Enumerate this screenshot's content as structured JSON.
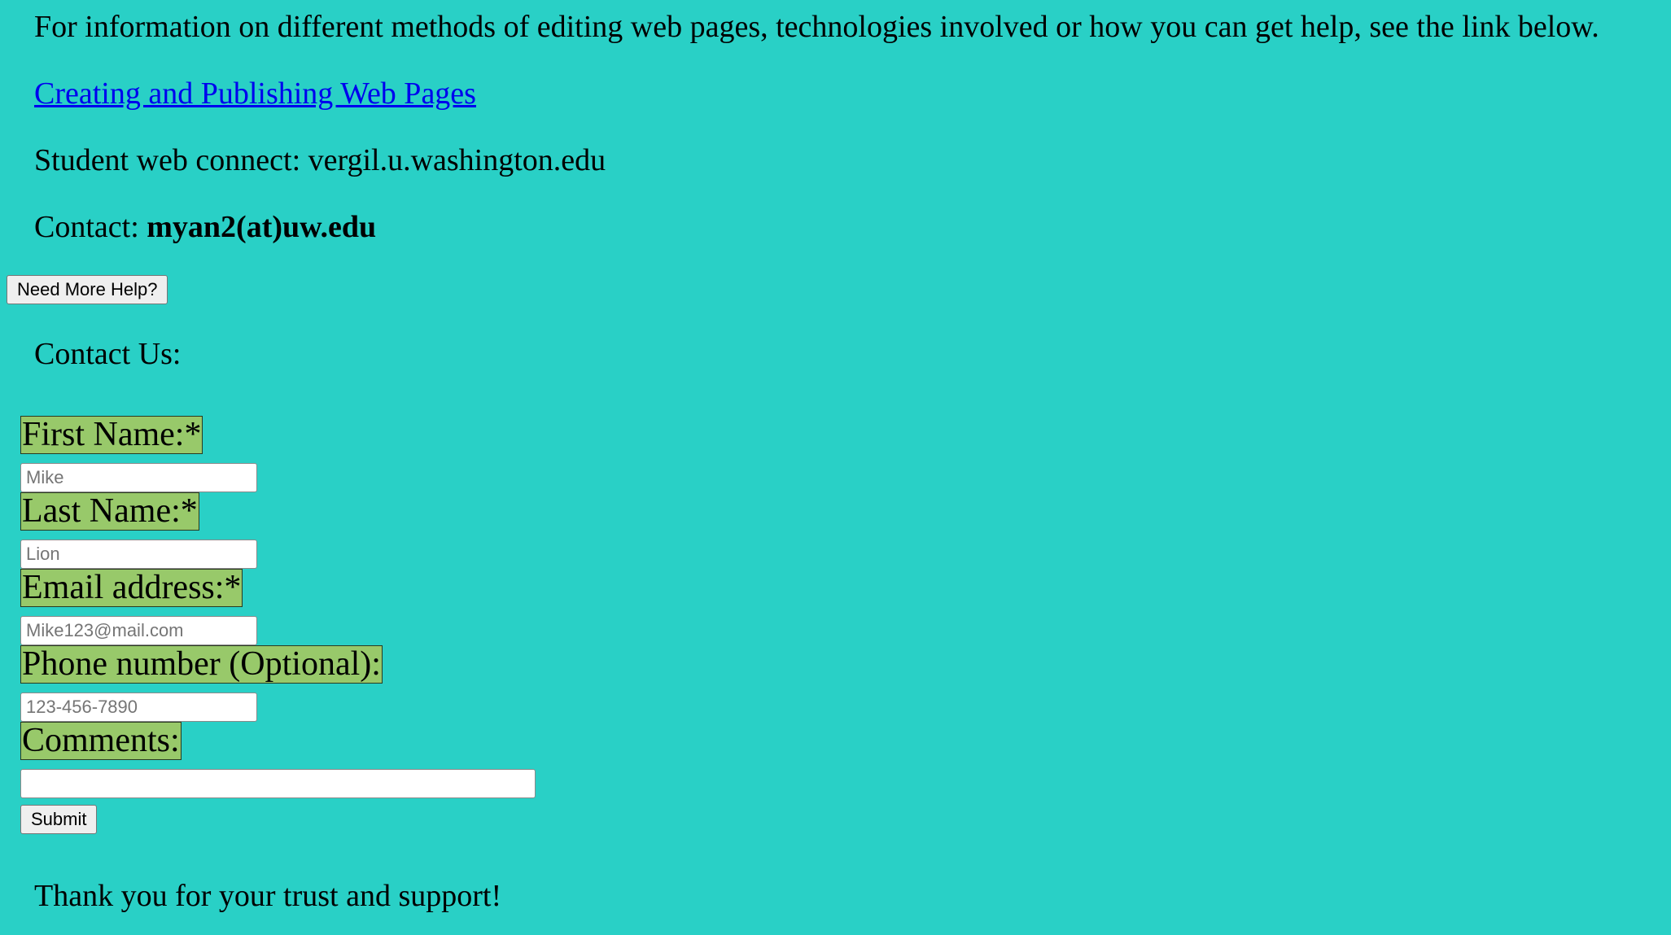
{
  "intro_text": "For information on different methods of editing web pages, technologies involved or how you can get help, see the link below.",
  "link_text": "Creating and Publishing Web Pages",
  "web_connect_text": "Student web connect: vergil.u.washington.edu",
  "contact": {
    "label": "Contact: ",
    "email": "myan2(at)uw.edu"
  },
  "help_button_label": "Need More Help?",
  "contact_us_heading": "Contact Us:",
  "form": {
    "first_name_label": "First Name:*",
    "first_name_placeholder": "Mike",
    "last_name_label": "Last Name:*",
    "last_name_placeholder": "Lion",
    "email_label": "Email address:*",
    "email_placeholder": "Mike123@mail.com",
    "phone_label": "Phone number (Optional):",
    "phone_placeholder": "123-456-7890",
    "comments_label": "Comments:",
    "comments_value": "",
    "submit_label": "Submit"
  },
  "thanks_text": "Thank you for your trust and support!",
  "colors": {
    "background": "#29d0c6",
    "label_background": "#98c96a",
    "link": "#0000ee"
  }
}
